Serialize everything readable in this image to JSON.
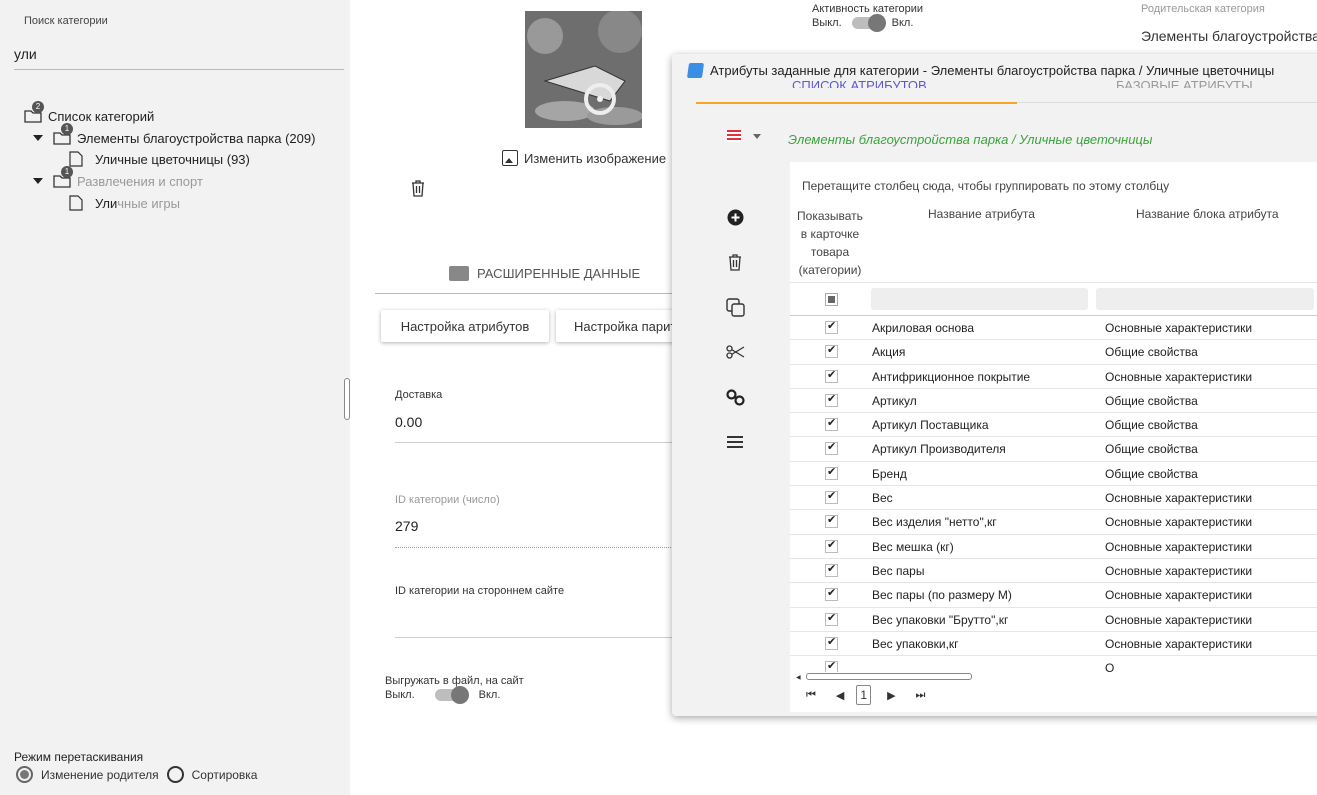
{
  "search": {
    "label": "Поиск категории",
    "value": "ули"
  },
  "tree": {
    "root": {
      "label": "Список категорий",
      "badge": "2"
    },
    "items": [
      {
        "label": "Элементы благоустройства парка (209)",
        "badge": "1"
      },
      {
        "label": "Уличные цветочницы (93)"
      },
      {
        "label": "Развлечения и спорт",
        "badge": "1"
      },
      {
        "label_highlight": "Ули",
        "label_rest": "чные игры"
      }
    ]
  },
  "drag_mode": {
    "label": "Режим перетаскивания",
    "options": [
      "Изменение родителя",
      "Сортировка"
    ],
    "selected": "Изменение родителя"
  },
  "form": {
    "change_image": "Изменить изображение",
    "extended_data": "РАСШИРЕННЫЕ ДАННЫЕ",
    "buttons": {
      "attr_settings": "Настройка атрибутов",
      "param_settings": "Настройка парит"
    },
    "delivery": {
      "label": "Доставка",
      "value": "0.00"
    },
    "category_id": {
      "label": "ID категории (число)",
      "value": "279"
    },
    "external_id": {
      "label": "ID категории на стороннем сайте",
      "value": ""
    },
    "export_toggle": {
      "label": "Выгружать в файл, на сайт",
      "off": "Выкл.",
      "on": "Вкл.",
      "state": "on"
    },
    "active_toggle": {
      "label": "Активность категории",
      "off": "Выкл.",
      "on": "Вкл.",
      "state": "on"
    },
    "parent": {
      "label": "Родительская категория",
      "value": "Элементы благоустройства"
    }
  },
  "modal": {
    "title": "Атрибуты заданные для категории - Элементы благоустройства парка / Уличные цветочницы",
    "tabs": [
      "СПИСОК АТРИБУТОВ",
      "БАЗОВЫЕ АТРИБУТЫ"
    ],
    "breadcrumb": "Элементы благоустройства парка / Уличные цветочницы",
    "group_hint": "Перетащите столбец сюда, чтобы группировать по этому столбцу",
    "columns": {
      "show": "Показывать в карточке товара (категории)",
      "name": "Название атрибута",
      "block": "Название блока атрибута"
    },
    "rows": [
      {
        "name": "Акриловая основа",
        "block": "Основные характеристики"
      },
      {
        "name": "Акция",
        "block": "Общие свойства"
      },
      {
        "name": "Антифрикционное покрытие",
        "block": "Основные характеристики"
      },
      {
        "name": "Артикул",
        "block": "Общие свойства"
      },
      {
        "name": "Артикул Поставщика",
        "block": "Общие свойства"
      },
      {
        "name": "Артикул Производителя",
        "block": "Общие свойства"
      },
      {
        "name": "Бренд",
        "block": "Общие свойства"
      },
      {
        "name": "Вес",
        "block": "Основные характеристики"
      },
      {
        "name": "Вес изделия \"нетто\",кг",
        "block": "Основные характеристики"
      },
      {
        "name": "Вес мешка (кг)",
        "block": "Основные характеристики"
      },
      {
        "name": "Вес пары",
        "block": "Основные характеристики"
      },
      {
        "name": "Вес пары (по размеру М)",
        "block": "Основные характеристики"
      },
      {
        "name": "Вес упаковки \"Брутто\",кг",
        "block": "Основные характеристики"
      },
      {
        "name": "Вес упаковки,кг",
        "block": "Основные характеристики"
      },
      {
        "name": "",
        "block": "О"
      }
    ],
    "pager": {
      "page": "1"
    },
    "colors": {
      "breadcrumb": "#3aa53a",
      "active_tab_underline": "#f5a623",
      "active_tab_text": "#5a5ad0"
    }
  }
}
